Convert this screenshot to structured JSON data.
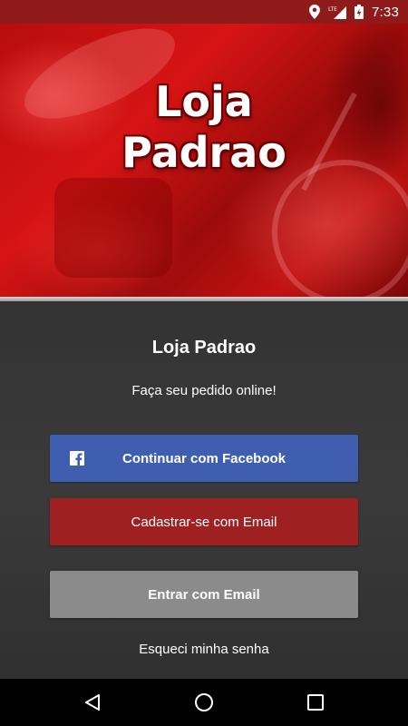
{
  "status_bar": {
    "network_label": "LTE",
    "time": "7:33",
    "icons": [
      "location-icon",
      "signal-icon",
      "battery-icon"
    ]
  },
  "hero": {
    "title_line1": "Loja",
    "title_line2": "Padrao"
  },
  "main": {
    "app_name": "Loja Padrao",
    "tagline": "Faça seu pedido online!",
    "facebook_button_label": "Continuar com Facebook",
    "signup_button_label": "Cadastrar-se com Email",
    "login_button_label": "Entrar com Email",
    "forgot_password_label": "Esqueci minha senha"
  },
  "colors": {
    "status_bar": "#8e1a1a",
    "facebook": "#3f5eb0",
    "signup": "#9f2020",
    "login": "#8b8b8b",
    "background": "#333333"
  },
  "nav_bar": {
    "icons": [
      "back-icon",
      "home-icon",
      "recents-icon"
    ]
  }
}
